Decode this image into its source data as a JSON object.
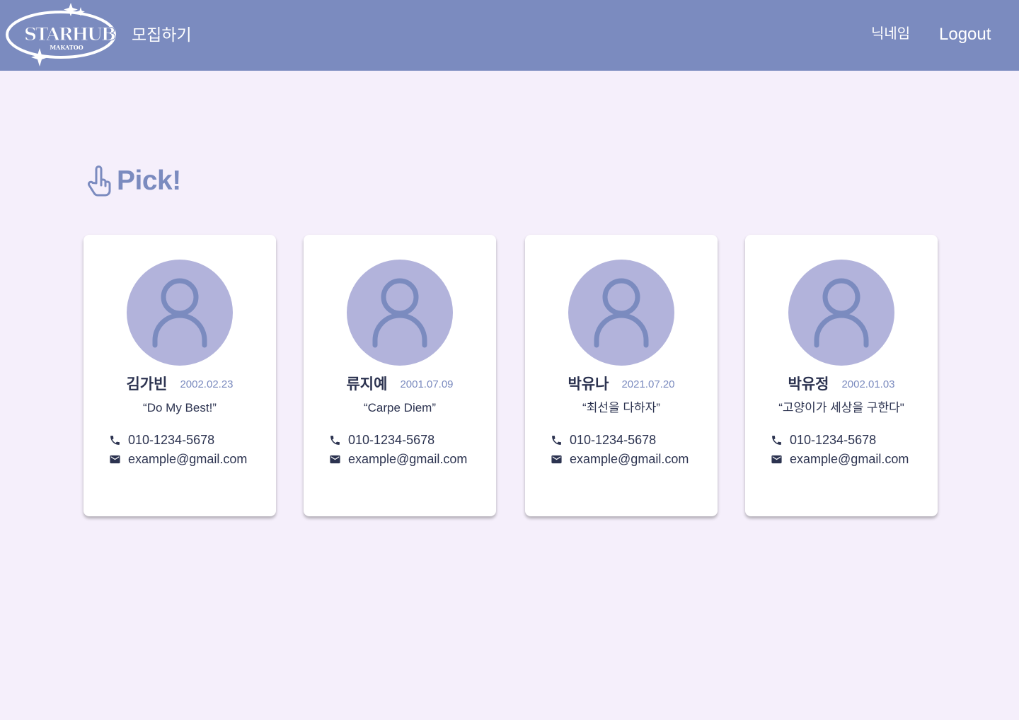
{
  "header": {
    "logo_text": "STARHUB",
    "logo_subtext": "MAKATOO",
    "nav_recruit": "모집하기",
    "nav_nickname": "닉네임",
    "nav_logout": "Logout",
    "background_color": "#7b8bbf"
  },
  "page": {
    "section_title": "Pick!",
    "section_icon": "pointing-hand-icon",
    "background_color": "#f5effb"
  },
  "cards": [
    {
      "name": "김가빈",
      "birth": "2002.02.23",
      "motto": "“Do My Best!”",
      "phone": "010-1234-5678",
      "email": "example@gmail.com"
    },
    {
      "name": "류지예",
      "birth": "2001.07.09",
      "motto": "“Carpe Diem”",
      "phone": "010-1234-5678",
      "email": "example@gmail.com"
    },
    {
      "name": "박유나",
      "birth": "2021.07.20",
      "motto": "“최선을 다하자”",
      "phone": "010-1234-5678",
      "email": "example@gmail.com"
    },
    {
      "name": "박유정",
      "birth": "2002.01.03",
      "motto": "“고양이가 세상을 구한다\"",
      "phone": "010-1234-5678",
      "email": "example@gmail.com"
    }
  ],
  "icons": {
    "avatar": "user-icon",
    "phone": "phone-icon",
    "email": "mail-icon"
  },
  "colors": {
    "accent": "#7b8bbf",
    "avatar_bg": "#b2b3db",
    "text_dark": "#2c3350"
  }
}
